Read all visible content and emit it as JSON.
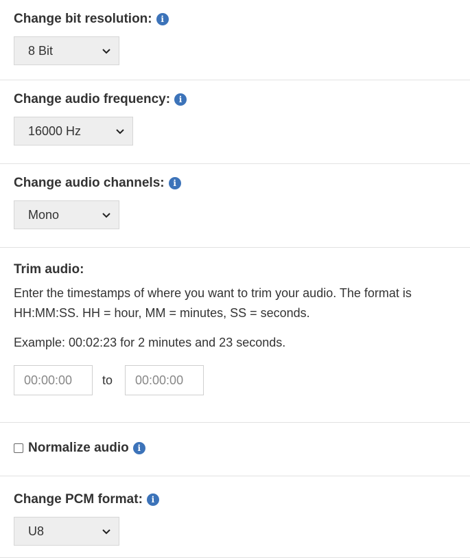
{
  "bit_resolution": {
    "label": "Change bit resolution:",
    "selected": "8 Bit"
  },
  "audio_frequency": {
    "label": "Change audio frequency:",
    "selected": "16000 Hz"
  },
  "audio_channels": {
    "label": "Change audio channels:",
    "selected": "Mono"
  },
  "trim": {
    "label": "Trim audio:",
    "description": "Enter the timestamps of where you want to trim your audio. The format is HH:MM:SS. HH = hour, MM = minutes, SS = seconds.",
    "example": "Example: 00:02:23 for 2 minutes and 23 seconds.",
    "start_placeholder": "00:00:00",
    "to_label": "to",
    "end_placeholder": "00:00:00"
  },
  "normalize": {
    "label": "Normalize audio",
    "checked": false
  },
  "pcm_format": {
    "label": "Change PCM format:",
    "selected": "U8"
  },
  "icons": {
    "info": "info-icon",
    "dropdown": "chevron-down-icon"
  },
  "colors": {
    "info_icon": "#3c73b9",
    "select_bg": "#eeeeee",
    "divider": "#e2e2e2"
  }
}
